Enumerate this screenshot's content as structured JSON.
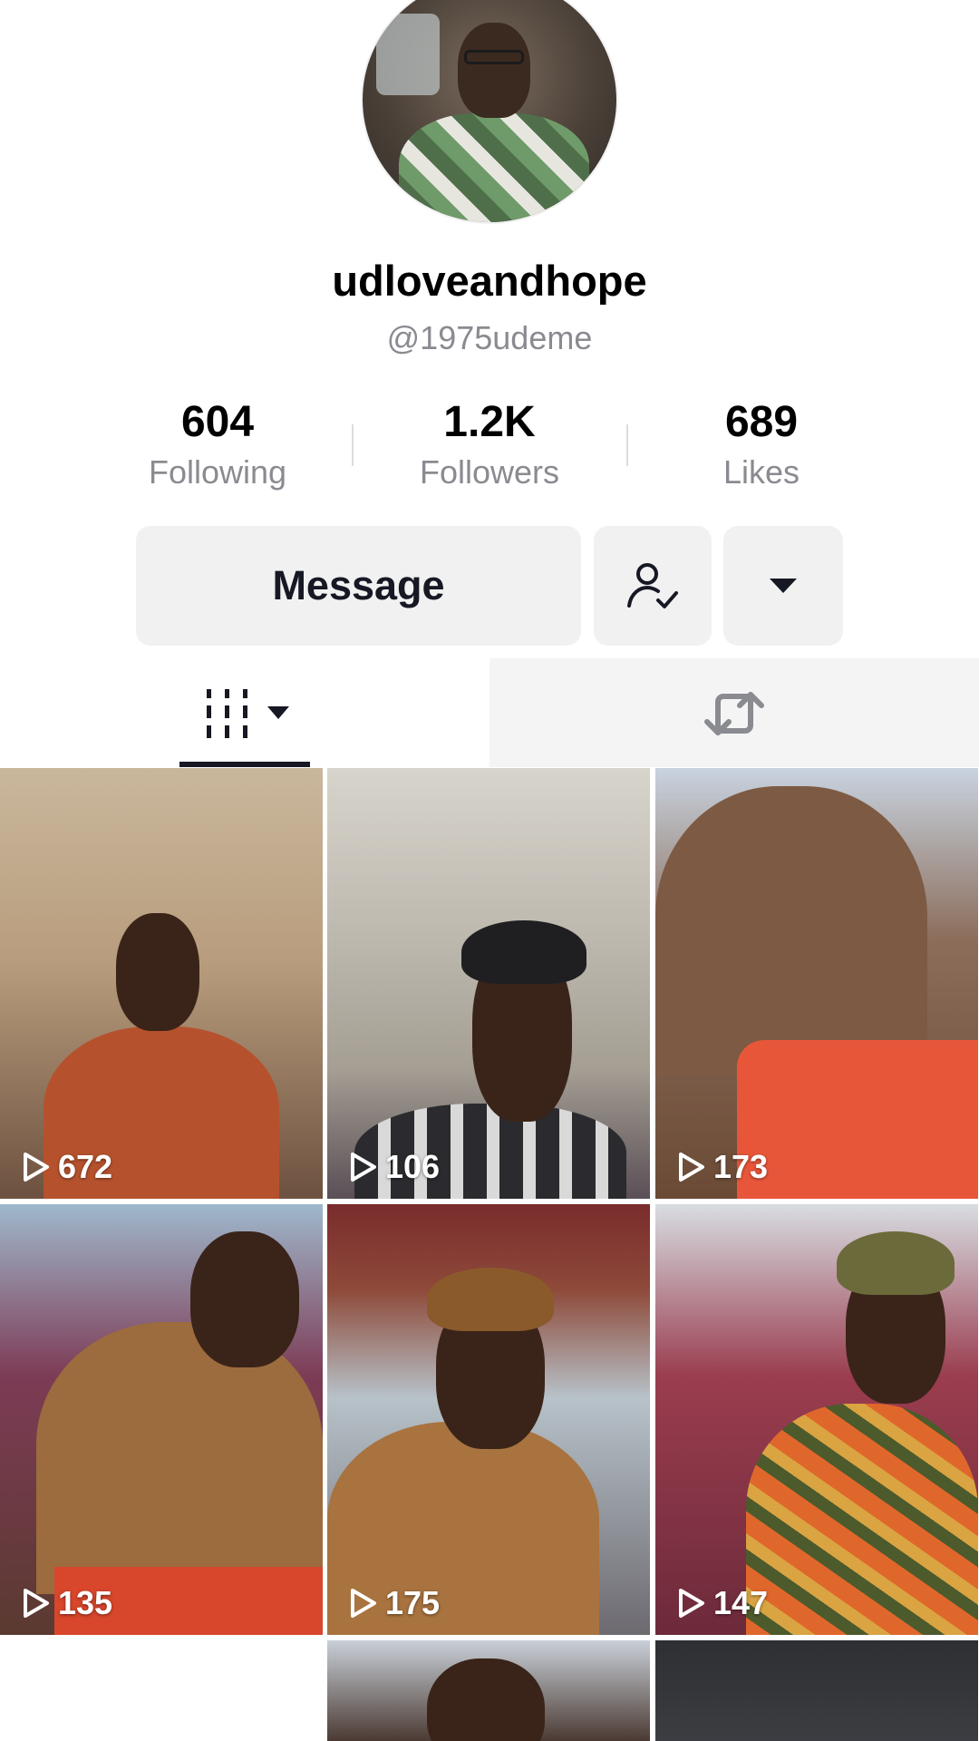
{
  "profile": {
    "username": "udloveandhope",
    "handle": "@1975udeme"
  },
  "stats": [
    {
      "value": "604",
      "label": "Following"
    },
    {
      "value": "1.2K",
      "label": "Followers"
    },
    {
      "value": "689",
      "label": "Likes"
    }
  ],
  "actions": {
    "message_label": "Message",
    "friend_icon": "person-check-icon",
    "more_icon": "caret-down-icon"
  },
  "tabs": {
    "videos_icon": "grid-videos-icon",
    "reposts_icon": "repost-icon",
    "active": "videos"
  },
  "videos": [
    {
      "views": "672"
    },
    {
      "views": "106"
    },
    {
      "views": "173"
    },
    {
      "views": "135"
    },
    {
      "views": "175"
    },
    {
      "views": "147"
    }
  ],
  "colors": {
    "button_bg": "#f1f1f2",
    "text_primary": "#161823",
    "text_secondary": "#8a8b91"
  }
}
